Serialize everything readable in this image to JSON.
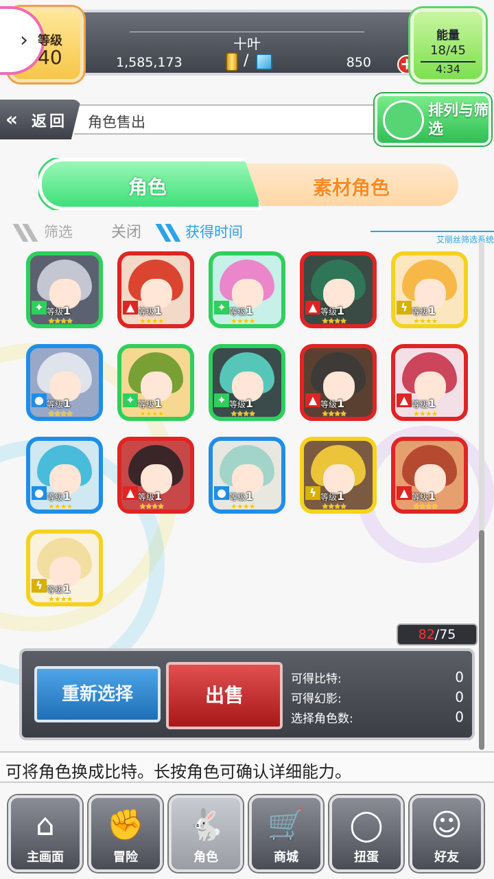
{
  "header": {
    "level_label": "等级",
    "level_value": "40",
    "player_name": "十叶",
    "gold": "1,585,173",
    "currency_separator": "/",
    "gems": "850",
    "energy_label": "能量",
    "energy_value": "18/45",
    "energy_timer": "4:34"
  },
  "nav": {
    "back_label": "返回",
    "page_title": "角色售出",
    "sort_filter_label": "排列与筛选"
  },
  "tabs": {
    "character": "角色",
    "material": "素材角色"
  },
  "filter": {
    "filter_label": "筛选",
    "filter_state": "关闭",
    "sort_by": "获得时间",
    "system_label": "艾丽丝筛选系统"
  },
  "characters": [
    {
      "level_prefix": "等级",
      "level": "1",
      "element": "wind",
      "frame": "#2ecf5c",
      "hair": "#cfd3dc",
      "bg": "#5b6170"
    },
    {
      "level_prefix": "等级",
      "level": "1",
      "element": "fire",
      "frame": "#e02424",
      "hair": "#d8341f",
      "bg": "#f3d9c8"
    },
    {
      "level_prefix": "等级",
      "level": "1",
      "element": "wind",
      "frame": "#2ecf5c",
      "hair": "#f07ac8",
      "bg": "#c6f0e8"
    },
    {
      "level_prefix": "等级",
      "level": "1",
      "element": "fire",
      "frame": "#e02424",
      "hair": "#2f7a5a",
      "bg": "#3a4a44"
    },
    {
      "level_prefix": "等级",
      "level": "1",
      "element": "thunder",
      "frame": "#f5d21e",
      "hair": "#f7b23a",
      "bg": "#fbe6c0"
    },
    {
      "level_prefix": "等级",
      "level": "1",
      "element": "water",
      "frame": "#1f8ee8",
      "hair": "#e6e9ef",
      "bg": "#9aa8c8"
    },
    {
      "level_prefix": "等级",
      "level": "1",
      "element": "wind",
      "frame": "#2ecf5c",
      "hair": "#6a9a2a",
      "bg": "#f6d890"
    },
    {
      "level_prefix": "等级",
      "level": "1",
      "element": "wind",
      "frame": "#2ecf5c",
      "hair": "#5ad4c4",
      "bg": "#3b4a4a"
    },
    {
      "level_prefix": "等级",
      "level": "1",
      "element": "fire",
      "frame": "#e02424",
      "hair": "#3a3a3a",
      "bg": "#5a4030"
    },
    {
      "level_prefix": "等级",
      "level": "1",
      "element": "fire",
      "frame": "#e02424",
      "hair": "#c8344a",
      "bg": "#f2e0e6"
    },
    {
      "level_prefix": "等级",
      "level": "1",
      "element": "water",
      "frame": "#1f8ee8",
      "hair": "#3ab7d8",
      "bg": "#cfe8f2"
    },
    {
      "level_prefix": "等级",
      "level": "1",
      "element": "fire",
      "frame": "#e02424",
      "hair": "#2a2226",
      "bg": "#c84848"
    },
    {
      "level_prefix": "等级",
      "level": "1",
      "element": "water",
      "frame": "#1f8ee8",
      "hair": "#9ad2c8",
      "bg": "#e8e8e0"
    },
    {
      "level_prefix": "等级",
      "level": "1",
      "element": "thunder",
      "frame": "#f5d21e",
      "hair": "#f7cf3a",
      "bg": "#7a5a40"
    },
    {
      "level_prefix": "等级",
      "level": "1",
      "element": "fire",
      "frame": "#e02424",
      "hair": "#b0402a",
      "bg": "#e6a070"
    },
    {
      "level_prefix": "等级",
      "level": "1",
      "element": "thunder",
      "frame": "#f5d21e",
      "hair": "#f2dc9a",
      "bg": "#fbf2de"
    }
  ],
  "counter": {
    "current": "82",
    "separator": "/",
    "max": "75"
  },
  "action": {
    "reselect_label": "重新选择",
    "sell_label": "出售",
    "bits_label": "可得比特:",
    "bits_value": "0",
    "phantom_label": "可得幻影:",
    "phantom_value": "0",
    "selected_label": "选择角色数:",
    "selected_value": "0"
  },
  "hint": "可将角色换成比特。长按角色可确认详细能力。",
  "bottom_nav": [
    {
      "label": "主画面",
      "icon": "home-icon",
      "glyph": "⌂"
    },
    {
      "label": "冒险",
      "icon": "handshake-icon",
      "glyph": "✊"
    },
    {
      "label": "角色",
      "icon": "rabbit-icon",
      "glyph": "🐇"
    },
    {
      "label": "商城",
      "icon": "cart-icon",
      "glyph": "🛒"
    },
    {
      "label": "扭蛋",
      "icon": "egg-icon",
      "glyph": "◯"
    },
    {
      "label": "好友",
      "icon": "friends-icon",
      "glyph": "☺"
    }
  ]
}
